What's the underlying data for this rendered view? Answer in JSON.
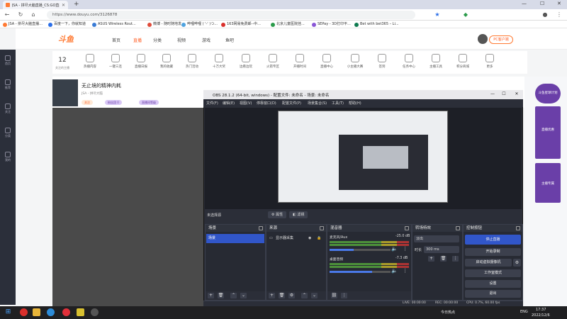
{
  "browser": {
    "tabs": [
      {
        "title": "JSA - 拼尽大脑直播_CS:GO直播",
        "active": true
      }
    ],
    "url": "https://www.douyu.com/3126878",
    "bookmarks": [
      "JSA - 拼尽大脑直播...",
      "百度一下，你就知道",
      "ASUS Wireless Rout...",
      "微博 - 随时随地发...",
      "哔哩哔哩 ( '-' )つ...",
      "163网易免费邮--中...",
      "北京儿童医院挂...",
      "SEPay - 3D打印平...",
      "Bet with bet365 – Li..."
    ]
  },
  "site": {
    "logo": "斗鱼",
    "nav": [
      "首页",
      "直播",
      "分类",
      "视频",
      "游戏",
      "鱼吧"
    ],
    "pc_button": "PC客户端",
    "follow_count": "12",
    "follow_label": "关注的主播",
    "actions": [
      "热播内容",
      "一键三连",
      "直播日报",
      "我的收藏",
      "热门活动",
      "十万大奖",
      "边看边玩",
      "火箭专区",
      "开播时间",
      "直播中心",
      "小主播大赛",
      "签到",
      "任务中心",
      "主播工具",
      "积分商城",
      "更多"
    ],
    "stream_title": "无止境的精神内耗",
    "stream_sub": "JSA - 拼尽大脑",
    "tags": [
      "关注",
      "粉丝团 0",
      "直播间等级"
    ],
    "left_nav": [
      "首页",
      "推荐",
      "关注",
      "分类",
      "我的"
    ],
    "side_cards": [
      "斗鱼星球计划",
      "直播优惠",
      "主播专属"
    ]
  },
  "obs": {
    "title": "OBS 28.1.2 (64-bit, windows) - 配置文件: 未命名 - 场景: 未命名",
    "menu": [
      "文件(F)",
      "编辑(E)",
      "视图(V)",
      "停靠窗口(D)",
      "配置文件(P)",
      "场景集合(S)",
      "工具(T)",
      "帮助(H)"
    ],
    "no_source": "未选择源",
    "properties_btn": "属性",
    "filters_btn": "滤镜",
    "docks": {
      "scenes": "场景",
      "sources": "来源",
      "mixer": "混音器",
      "transitions": "转场特效",
      "controls": "控制按钮"
    },
    "scene_items": [
      "场景"
    ],
    "source_items": [
      "显示器采集"
    ],
    "mixer": [
      {
        "name": "麦克风/Aux",
        "db": "-25.0 dB"
      },
      {
        "name": "桌面音频",
        "db": "-7.3 dB"
      }
    ],
    "transition": {
      "type": "淡出",
      "duration_label": "时长",
      "duration": "300 ms"
    },
    "controls": [
      "停止直播",
      "开始录制",
      "启动虚拟摄像机",
      "工作室模式",
      "设置",
      "退出"
    ],
    "status": {
      "live": "LIVE: 00:00:00",
      "rec": "REC: 00:00:00",
      "cpu": "CPU: 0.7%, 60.00 fps"
    }
  },
  "taskbar": {
    "weather": "今日热点",
    "lang": "ENG",
    "time": "17:37",
    "date": "2022/12/6"
  },
  "colors": {
    "accent": "#ff5d23",
    "obs_blue": "#3156c9",
    "obs_bg": "#2b2e38"
  }
}
